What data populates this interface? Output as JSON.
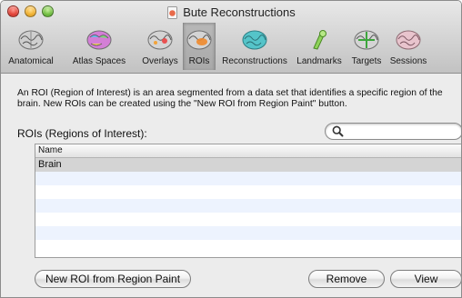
{
  "window": {
    "title": "Bute Reconstructions"
  },
  "toolbar": {
    "items": [
      {
        "label": "Anatomical",
        "icon": "anatomical-brain-icon"
      },
      {
        "label": "Atlas Spaces",
        "icon": "atlas-brain-icon"
      },
      {
        "label": "Overlays",
        "icon": "overlays-brain-icon"
      },
      {
        "label": "ROIs",
        "icon": "roi-brain-icon",
        "selected": true
      },
      {
        "label": "Reconstructions",
        "icon": "reconstruction-brain-icon"
      },
      {
        "label": "Landmarks",
        "icon": "landmark-pin-icon"
      },
      {
        "label": "Targets",
        "icon": "targets-brain-icon"
      },
      {
        "label": "Sessions",
        "icon": "sessions-brain-icon"
      }
    ]
  },
  "main": {
    "description": "An ROI (Region of Interest) is an area segmented from a data set that identifies a specific region of the brain. New ROIs can be created using the \"New ROI from Region Paint\" button.",
    "section_label": "ROIs (Regions of Interest):",
    "search": {
      "value": "",
      "placeholder": ""
    },
    "table": {
      "columns": [
        "Name"
      ],
      "rows": [
        "Brain"
      ],
      "selected_row": 0
    }
  },
  "buttons": {
    "new_roi": "New ROI from Region Paint",
    "remove": "Remove",
    "view": "View"
  },
  "colors": {
    "selection": "#d4d4d4",
    "stripe": "#edf3fe"
  }
}
